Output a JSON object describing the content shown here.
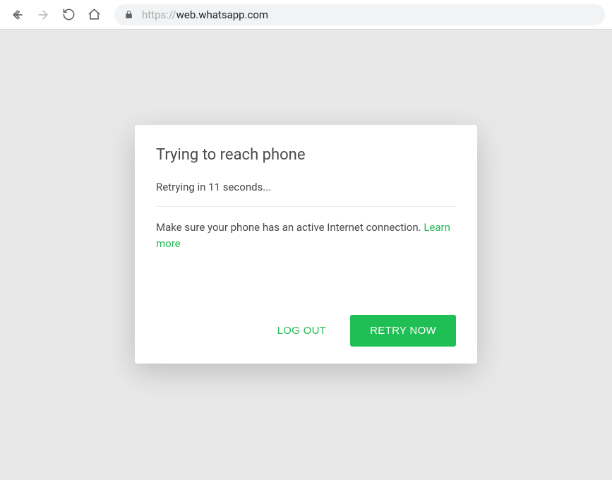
{
  "browser": {
    "url_prefix": "https://",
    "url_domain": "web.whatsapp.com",
    "url_path": ""
  },
  "dialog": {
    "title": "Trying to reach phone",
    "status": "Retrying in 11 seconds...",
    "help_text": "Make sure your phone has an active Internet connection. ",
    "learn_more": "Learn more",
    "logout_label": "LOG OUT",
    "retry_label": "RETRY NOW"
  },
  "colors": {
    "accent": "#26b954",
    "primary_button": "#1fbf55"
  }
}
